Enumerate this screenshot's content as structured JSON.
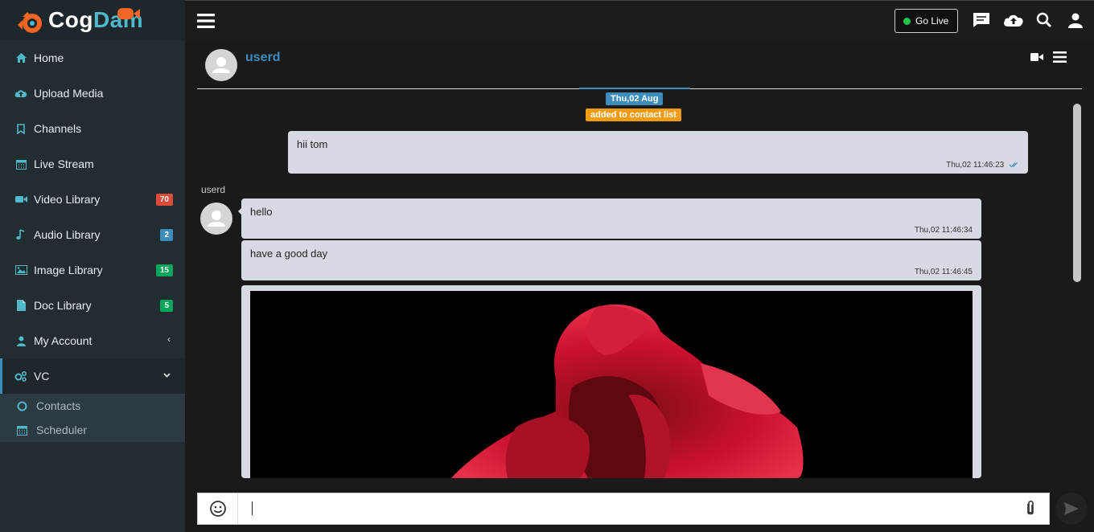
{
  "brand": {
    "part1": "Cog",
    "part2": "Dam"
  },
  "sidebar": {
    "items": [
      {
        "label": "Home",
        "icon": "home-icon"
      },
      {
        "label": "Upload Media",
        "icon": "cloud-upload-icon"
      },
      {
        "label": "Channels",
        "icon": "bookmark-icon"
      },
      {
        "label": "Live Stream",
        "icon": "calendar-icon"
      },
      {
        "label": "Video Library",
        "icon": "video-icon",
        "badge": "70",
        "badge_color": "#dd4b39"
      },
      {
        "label": "Audio Library",
        "icon": "music-icon",
        "badge": "2",
        "badge_color": "#3c8dbc"
      },
      {
        "label": "Image Library",
        "icon": "image-icon",
        "badge": "15",
        "badge_color": "#00a65a"
      },
      {
        "label": "Doc Library",
        "icon": "file-icon",
        "badge": "5",
        "badge_color": "#00a65a"
      },
      {
        "label": "My Account",
        "icon": "user-icon",
        "chevron": "‹"
      },
      {
        "label": "VC",
        "icon": "cogs-icon",
        "chevron": "⌄"
      }
    ],
    "submenu": [
      {
        "label": "Contacts",
        "icon": "circle-icon"
      },
      {
        "label": "Scheduler",
        "icon": "calendar-icon"
      }
    ]
  },
  "topbar": {
    "golive_label": "Go Live"
  },
  "chat": {
    "contact_name": "userd",
    "date_label": "Thu,02 Aug",
    "contact_notice": "added to contact list",
    "messages": [
      {
        "text": "hii tom",
        "time": "Thu,02 11:46:23"
      },
      {
        "sender": "userd"
      },
      {
        "text": "hello",
        "time": "Thu,02 11:46:34"
      },
      {
        "text": "have a good day",
        "time": "Thu,02 11:46:45"
      }
    ]
  },
  "composer": {
    "value": ""
  },
  "colors": {
    "accent": "#3c8dbc",
    "sidebar_bg": "#222d32",
    "bubble": "#d8dae3",
    "notice": "#f39c12"
  }
}
